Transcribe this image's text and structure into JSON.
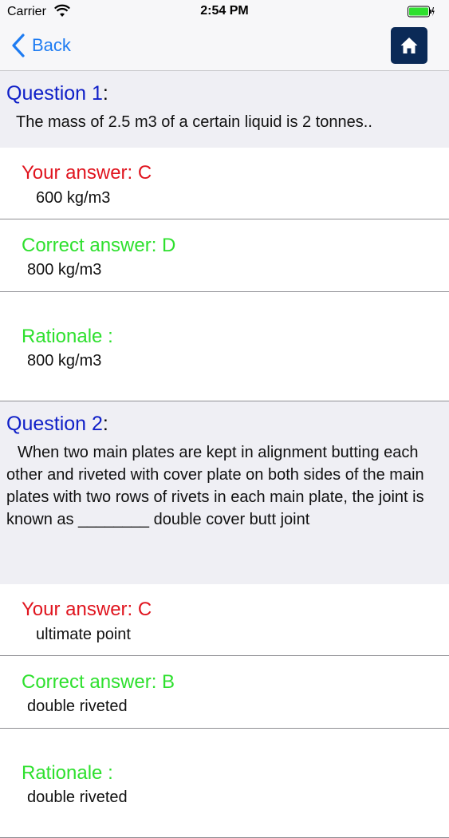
{
  "status_bar": {
    "carrier": "Carrier",
    "time": "2:54 PM"
  },
  "nav": {
    "back_label": "Back",
    "home_icon": "home-icon",
    "accent_color": "#1e7cf2",
    "home_bg": "#0b2a57"
  },
  "questions": [
    {
      "title": "Question 1",
      "text": "The mass of 2.5 m3 of a certain liquid is 2 tonnes..",
      "your_answer_label": "Your answer: C",
      "your_answer_value": "600 kg/m3",
      "correct_answer_label": "Correct answer: D",
      "correct_answer_value": "800 kg/m3",
      "rationale_label": "Rationale :",
      "rationale_value": "800 kg/m3"
    },
    {
      "title": "Question 2",
      "text": "When two main plates are kept in alignment butting each other and riveted with cover plate on both sides of the main plates with two rows of rivets in each main plate, the joint is known as ________ double cover butt joint",
      "your_answer_label": "Your answer: C",
      "your_answer_value": "ultimate point",
      "correct_answer_label": "Correct answer: B",
      "correct_answer_value": "double riveted",
      "rationale_label": "Rationale :",
      "rationale_value": "double riveted"
    }
  ],
  "colors": {
    "question_title": "#1020c8",
    "your_answer": "#e0141e",
    "correct_answer": "#2ee02e",
    "question_bg": "#efeff4"
  }
}
